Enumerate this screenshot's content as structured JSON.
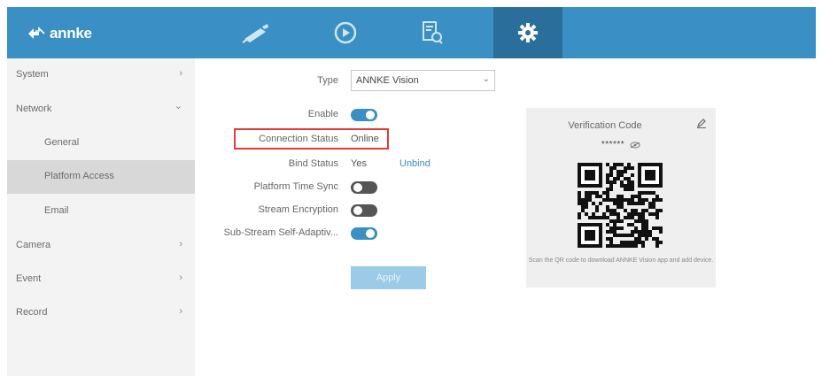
{
  "brand": {
    "name": "annke"
  },
  "tabs": [
    {
      "id": "live-view",
      "icon": "camera-icon"
    },
    {
      "id": "playback",
      "icon": "playback-icon"
    },
    {
      "id": "search",
      "icon": "file-search-icon"
    },
    {
      "id": "configuration",
      "icon": "gear-icon",
      "active": true
    }
  ],
  "sidebar": {
    "items": [
      {
        "label": "System",
        "chevron": "›"
      },
      {
        "label": "Network",
        "chevron": "⌄"
      },
      {
        "label": "General"
      },
      {
        "label": "Platform Access",
        "active": true
      },
      {
        "label": "Email"
      },
      {
        "label": "Camera",
        "chevron": "›"
      },
      {
        "label": "Event",
        "chevron": "›"
      },
      {
        "label": "Record",
        "chevron": "›"
      }
    ]
  },
  "form": {
    "type_label": "Type",
    "type_value": "ANNKE Vision",
    "enable_label": "Enable",
    "enable_on": true,
    "connection_status_label": "Connection Status",
    "connection_status_value": "Online",
    "bind_status_label": "Bind Status",
    "bind_status_value": "Yes",
    "unbind_label": "Unbind",
    "time_sync_label": "Platform Time Sync",
    "time_sync_on": false,
    "stream_encryption_label": "Stream Encryption",
    "stream_encryption_on": false,
    "sub_stream_label": "Sub-Stream Self-Adaptiv...",
    "sub_stream_on": true,
    "apply_label": "Apply"
  },
  "verification": {
    "title": "Verification Code",
    "code_masked": "******",
    "caption": "Scan the QR code to download ANNKE Vision app and add device."
  },
  "colors": {
    "header": "#3a8fc4",
    "active_tab": "#2a6f9b",
    "highlight": "#e23b3b",
    "link": "#3a8fc4"
  }
}
